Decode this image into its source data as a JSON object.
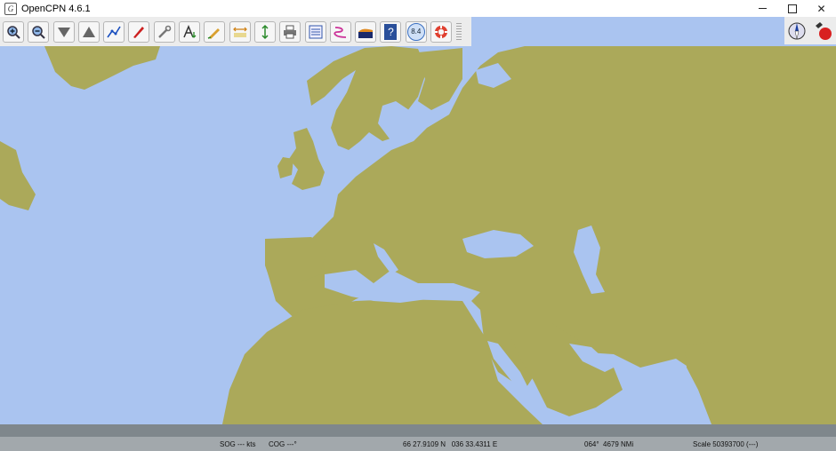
{
  "window": {
    "title": "OpenCPN 4.6.1",
    "app_icon_glyph": "G",
    "controls": [
      "minimize",
      "maximize",
      "close"
    ],
    "close_glyph": "✕"
  },
  "toolbar": {
    "buttons": [
      {
        "name": "zoom-in-button",
        "icon": "zoom-in-icon"
      },
      {
        "name": "zoom-out-button",
        "icon": "zoom-out-icon"
      },
      {
        "name": "scale-in-button",
        "icon": "scale-in-icon"
      },
      {
        "name": "scale-out-button",
        "icon": "scale-out-icon"
      },
      {
        "name": "create-route-button",
        "icon": "route-icon"
      },
      {
        "name": "auto-follow-button",
        "icon": "ship-icon"
      },
      {
        "name": "settings-button",
        "icon": "wrench-icon"
      },
      {
        "name": "text-button",
        "icon": "text-icon"
      },
      {
        "name": "mob-track-button",
        "icon": "track-pencil-icon"
      },
      {
        "name": "tide-button",
        "icon": "tide-arrows-icon"
      },
      {
        "name": "current-button",
        "icon": "current-arrows-icon"
      },
      {
        "name": "print-button",
        "icon": "printer-icon"
      },
      {
        "name": "route-manager-button",
        "icon": "checklist-icon"
      },
      {
        "name": "track-button",
        "icon": "track-icon"
      },
      {
        "name": "color-scheme-button",
        "icon": "color-scheme-icon"
      },
      {
        "name": "help-button",
        "icon": "help-icon",
        "label": "?"
      },
      {
        "name": "zoom-level-button",
        "icon": "zoom-level-icon",
        "label": "8.4"
      },
      {
        "name": "man-overboard-button",
        "icon": "lifebuoy-icon"
      }
    ]
  },
  "compass": {
    "icons": [
      "compass-icon",
      "gps-status-icon"
    ]
  },
  "map": {
    "sea_color": "#aac4f0",
    "land_color": "#aba95a"
  },
  "status": {
    "sog": "SOG --- kts",
    "cog": "COG ---°",
    "position": "66 27.9109 N   036 33.4311 E",
    "bearing": "064°  4679 NMi",
    "scale": "Scale 50393700 (---)"
  }
}
